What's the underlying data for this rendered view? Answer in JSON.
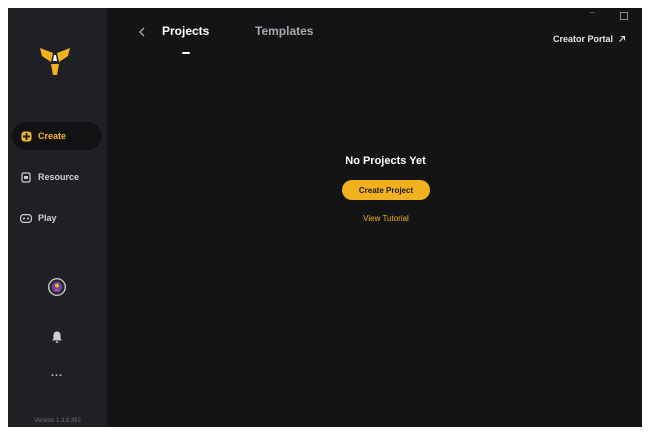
{
  "sidebar": {
    "nav": [
      {
        "label": "Create",
        "icon": "create-icon",
        "active": true
      },
      {
        "label": "Resource",
        "icon": "resource-icon",
        "active": false
      },
      {
        "label": "Play",
        "icon": "play-icon",
        "active": false
      }
    ],
    "more_label": "...",
    "version": "Version 1.3.8.392"
  },
  "header": {
    "tabs": [
      {
        "label": "Projects",
        "active": true
      },
      {
        "label": "Templates",
        "active": false
      }
    ],
    "creator_portal": "Creator Portal"
  },
  "main": {
    "empty_title": "No Projects Yet",
    "create_button": "Create Project",
    "tutorial_link": "View Tutorial"
  },
  "colors": {
    "accent": "#f2b21f",
    "background": "#141416",
    "sidebar": "#1f2023"
  }
}
